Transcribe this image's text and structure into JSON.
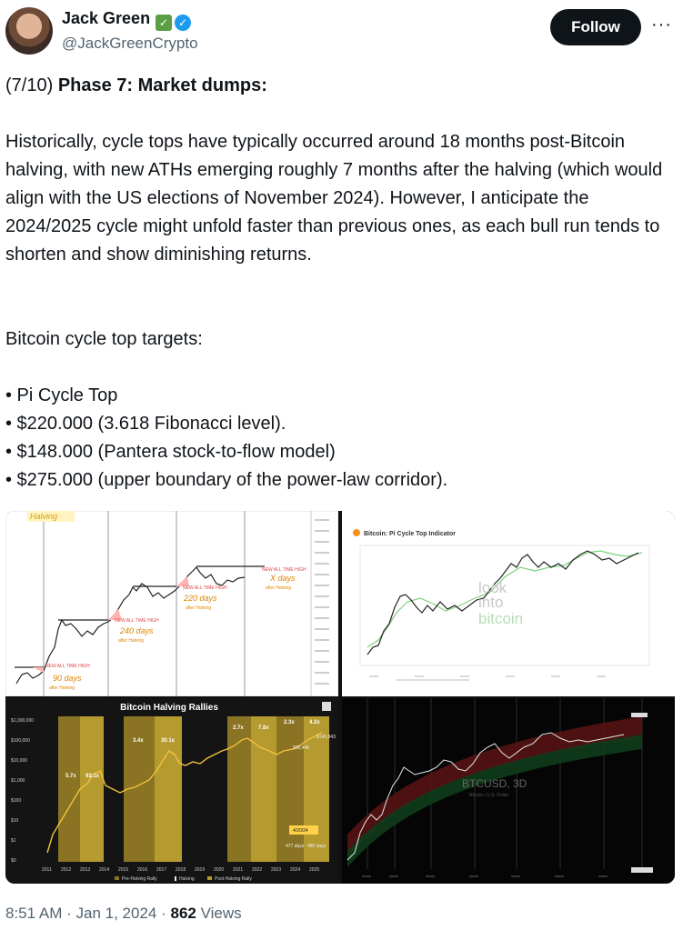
{
  "author": {
    "name": "Jack Green",
    "handle": "@JackGreenCrypto",
    "follow_label": "Follow",
    "more_label": "···"
  },
  "tweet": {
    "prefix": "(7/10)",
    "heading": "Phase 7: Market dumps:",
    "paragraph": "Historically, cycle tops have typically occurred around 18 months post-Bitcoin halving, with new ATHs emerging roughly 7 months after the halving (which would align with the US elections of November 2024). However, I anticipate the 2024/2025 cycle might unfold faster than previous ones, as each bull run tends to shorten and show diminishing returns.",
    "targets_title": "Bitcoin cycle top targets:",
    "targets": [
      "• Pi Cycle Top",
      "• $220.000 (3.618 Fibonacci level).",
      "• $148.000 (Pantera stock-to-flow model)",
      "• $275.000 (upper boundary of the power-law corridor)."
    ]
  },
  "images": {
    "halving_chart": {
      "label": "Halving",
      "annotations": [
        "NEW ALL TIME HIGH",
        "90 days",
        "after Halving",
        "240 days",
        "220 days",
        "X days"
      ]
    },
    "pi_cycle": {
      "title": "Bitcoin: Pi Cycle Top Indicator",
      "watermark": [
        "look",
        "into",
        "bitcoin"
      ]
    },
    "rallies": {
      "title": "Bitcoin Halving Rallies",
      "yticks": [
        "$1,000,000",
        "$100,000",
        "$10,000",
        "$1,000",
        "$100",
        "$10",
        "$1",
        "$0"
      ],
      "xticks": [
        "2011",
        "2012",
        "2013",
        "2014",
        "2015",
        "2016",
        "2017",
        "2018",
        "2019",
        "2020",
        "2021",
        "2022",
        "2023",
        "2024",
        "2025"
      ],
      "multipliers": [
        "5.7x",
        "93.1x",
        "3.4x",
        "30.1x",
        "2.7x",
        "7.8x",
        "2.3x",
        "4.2x"
      ],
      "prices": [
        "$145,843",
        "$36,446"
      ],
      "date": "4/20/24",
      "days": [
        "477 days",
        "480 days"
      ],
      "legend": [
        "Pre-Halving Rally",
        "Halving",
        "Post-Halving Rally"
      ]
    },
    "power_law": {
      "symbol": "BTCUSD, 3D",
      "subtitle": "Bitcoin / U.S. Dollar"
    }
  },
  "meta": {
    "time": "8:51 AM",
    "date": "Jan 1, 2024",
    "views": "862",
    "views_label": "Views"
  }
}
